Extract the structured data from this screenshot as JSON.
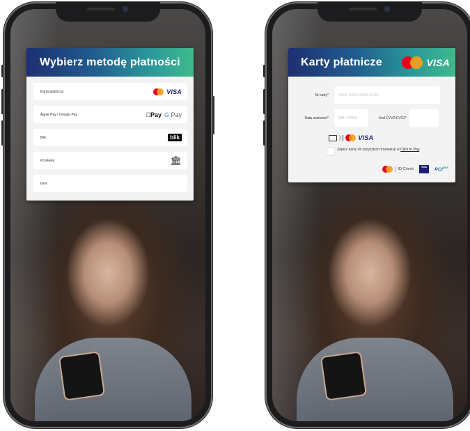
{
  "left": {
    "title": "Wybierz metodę płatności",
    "options": [
      {
        "label": "Karta płatnicza",
        "logos": [
          "mastercard-logo",
          "visa-logo"
        ]
      },
      {
        "label": "Apple Pay / Google Pay",
        "logos": [
          "apple-pay-logo",
          "google-pay-logo"
        ]
      },
      {
        "label": "Blik",
        "logos": [
          "blik-logo"
        ]
      },
      {
        "label": "Przelewy",
        "logos": [
          "bank-icon"
        ]
      },
      {
        "label": "Inne",
        "logos": []
      }
    ],
    "logo_text": {
      "visa": "VISA",
      "apple_pay": "Pay",
      "google_pay_g": "G",
      "google_pay": "Pay",
      "blik": "blik",
      "bank": "🏛"
    }
  },
  "right": {
    "title": "Karty płatnicze",
    "header_visa": "VISA",
    "card_number_label": "Nr karty*",
    "card_number_placeholder": "XXXX XXXX XXXX XXXX",
    "expiry_label": "Data ważności*",
    "expiry_placeholder": "MM / RRRR",
    "cvv_label": "Kod CVV2/CVC2*",
    "cvv_value": "",
    "visa_small": "VISA",
    "save_text": "Zapisz kartę do przyszłych transakcji w",
    "click_to_pay": "Click to Pay",
    "save_text_end": ".",
    "id_check": "ID Check",
    "visa_secure": "VISA",
    "pci": "PCI",
    "pci_sup": "DSS"
  },
  "colors": {
    "header_start": "#1e2f72",
    "header_end": "#3fb98c",
    "mastercard_red": "#eb001b",
    "mastercard_yellow": "#f79e1b",
    "visa_blue": "#1a1f71"
  }
}
